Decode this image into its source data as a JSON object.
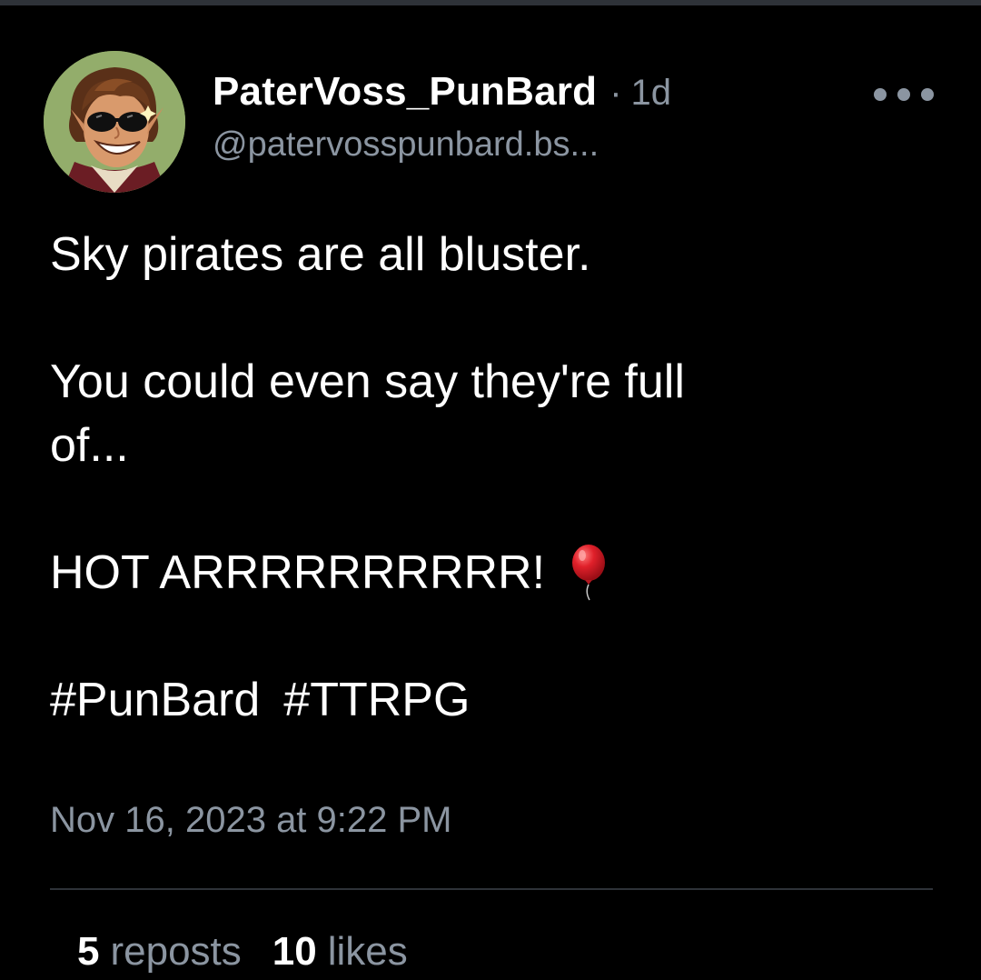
{
  "post": {
    "author": {
      "display_name": "PaterVoss_PunBard",
      "handle": "@patervosspunbard.bs...",
      "avatar_icon": "avatar-illustration"
    },
    "separator": "·",
    "time_ago": "1d",
    "more_icon": "ellipsis-icon",
    "lines": {
      "line1": "Sky pirates are all bluster.",
      "line2": "You could even say they're full",
      "line3": "of...",
      "line4": "HOT ARRRRRRRRRR!",
      "hashtag1": "#PunBard",
      "hashtag2": "#TTRPG"
    },
    "emoji_icon": "red-balloon-icon",
    "timestamp": "Nov 16, 2023 at 9:22 PM",
    "stats": {
      "reposts_count": "5",
      "reposts_label": "reposts",
      "likes_count": "10",
      "likes_label": "likes"
    }
  },
  "colors": {
    "background": "#000000",
    "text_primary": "#ffffff",
    "text_secondary": "#8b95a1",
    "divider": "#2e3238",
    "balloon": "#e0202a"
  }
}
